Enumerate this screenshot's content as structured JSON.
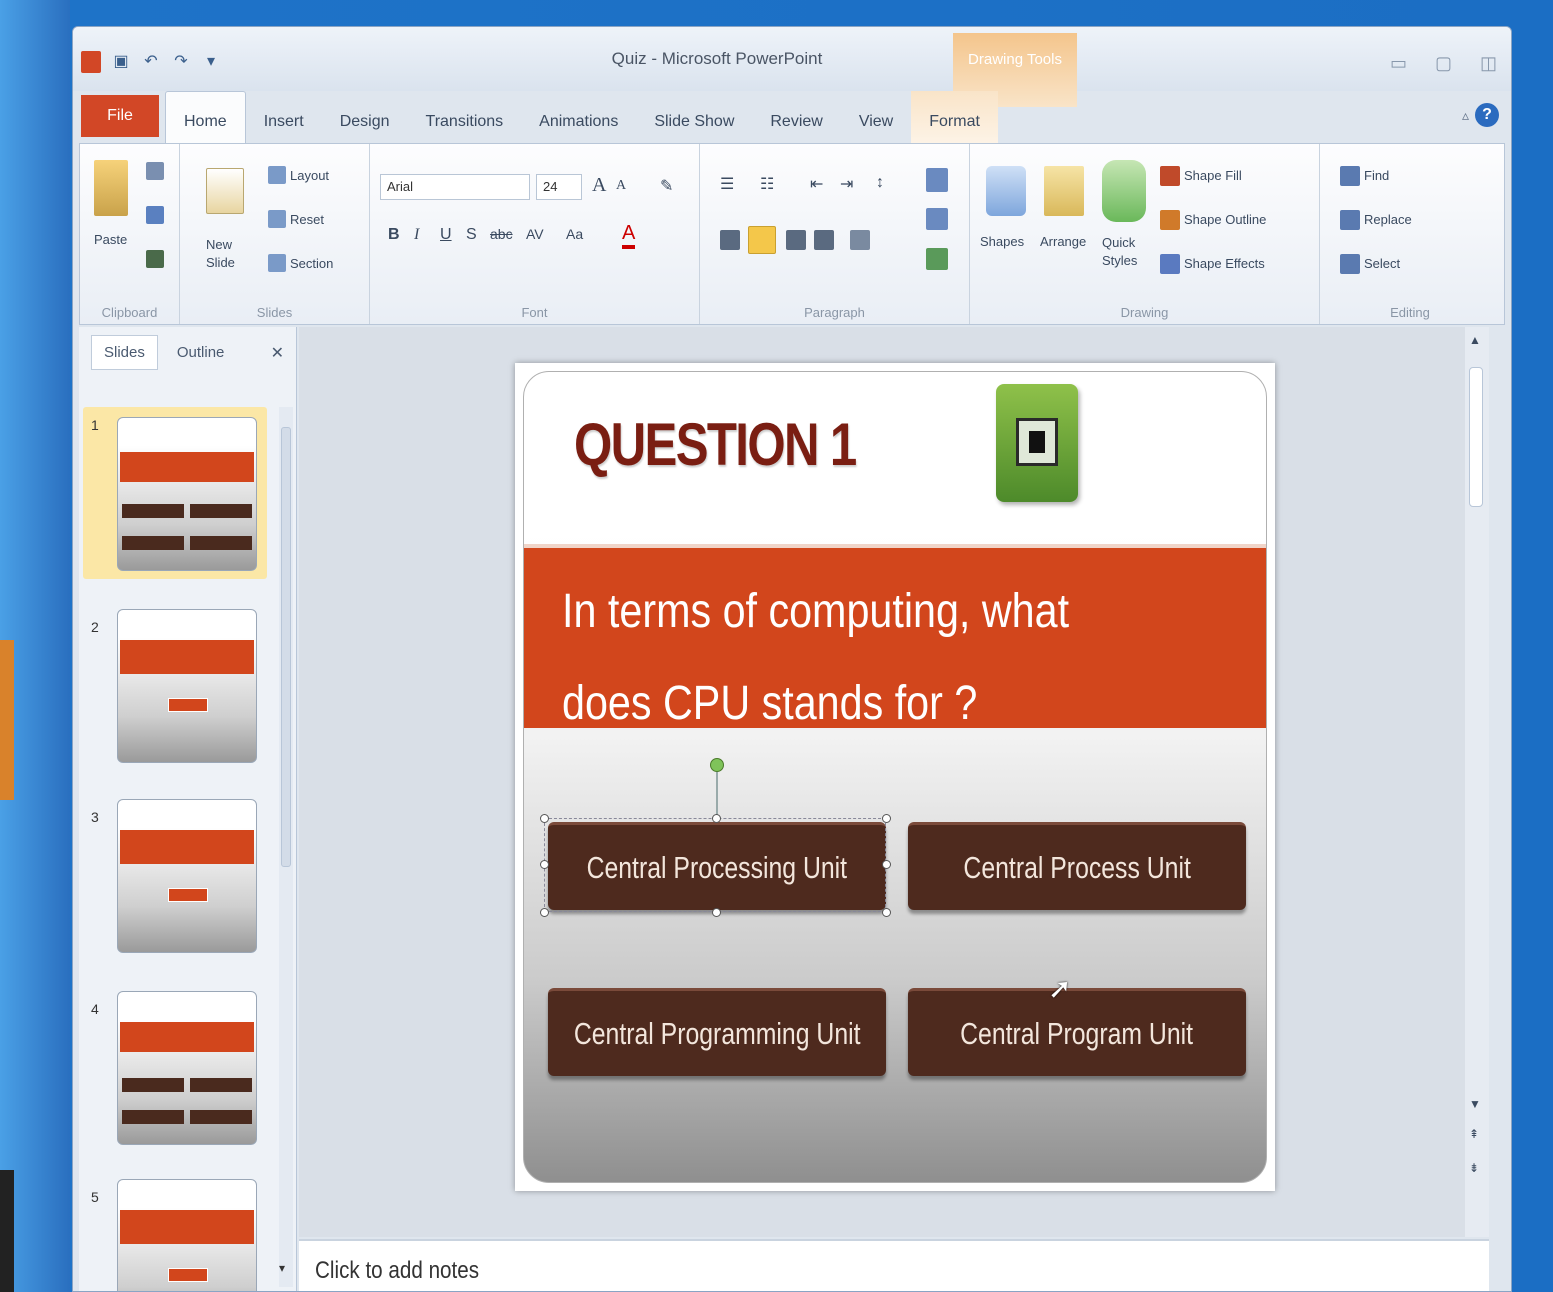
{
  "window": {
    "title": "Quiz - Microsoft PowerPoint",
    "contextual_tab": "Drawing Tools"
  },
  "tabs": [
    "File",
    "Home",
    "Insert",
    "Design",
    "Transitions",
    "Animations",
    "Slide Show",
    "Review",
    "View",
    "Format"
  ],
  "ribbon": {
    "clipboard": {
      "paste": "Paste",
      "label": "Clipboard"
    },
    "slides": {
      "new_slide": "New Slide",
      "layout": "Layout",
      "reset": "Reset",
      "section": "Section",
      "label": "Slides"
    },
    "font": {
      "font_name": "Arial",
      "font_size": "24",
      "label": "Font"
    },
    "paragraph": {
      "label": "Paragraph"
    },
    "drawing": {
      "shapes": "Shapes",
      "arrange": "Arrange",
      "quick_styles": "Quick Styles",
      "shape_fill": "Shape Fill",
      "shape_outline": "Shape Outline",
      "shape_effects": "Shape Effects",
      "label": "Drawing"
    },
    "editing": {
      "find": "Find",
      "replace": "Replace",
      "select": "Select",
      "label": "Editing"
    }
  },
  "left_panel": {
    "tabs": [
      "Slides",
      "Outline"
    ],
    "slide_numbers": [
      "1",
      "2",
      "3",
      "4",
      "5"
    ]
  },
  "slide": {
    "title": "QUESTION 1",
    "question": "In terms of computing, what does CPU stands for ?",
    "answers": [
      "Central Processing Unit",
      "Central Process Unit",
      "Central Programming Unit",
      "Central Program Unit"
    ]
  },
  "notes": {
    "placeholder": "Click to add notes"
  },
  "colors": {
    "accent": "#d2461c",
    "answer_bg": "#4e2a1e",
    "file_tab": "#d24726"
  }
}
